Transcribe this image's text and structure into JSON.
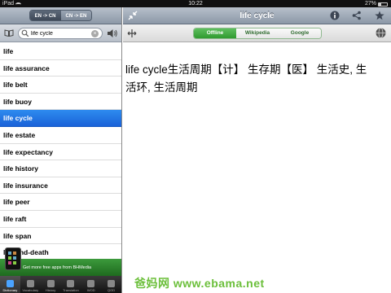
{
  "statusbar": {
    "carrier": "iPad",
    "time": "10:22",
    "battery": "27%"
  },
  "lang_toggle": {
    "en_cn": "EN -> CN",
    "cn_en": "CN -> EN"
  },
  "search": {
    "value": "life cycle",
    "placeholder": ""
  },
  "words": [
    "life",
    "life assurance",
    "life belt",
    "life buoy",
    "life cycle",
    "life estate",
    "life expectancy",
    "life history",
    "life insurance",
    "life peer",
    "life raft",
    "life span",
    "life-and-death"
  ],
  "selected_index": 4,
  "ad": {
    "text": "Get more free apps from BHMedia"
  },
  "tabs": [
    "Dictionary",
    "Vocabulary",
    "History",
    "Translation",
    "WOD",
    "QOD"
  ],
  "detail": {
    "title": "life cycle"
  },
  "sources": {
    "offline": "Offline",
    "wikipedia": "Wikipedia",
    "google": "Google"
  },
  "definition": "life cycle生活周期【计】 生存期【医】 生活史, 生活环, 生活周期",
  "watermark": "爸妈网 www.ebama.net",
  "colors": {
    "accent": "#1a62d8",
    "green": "#2f9a2f",
    "navbar": "#8c98a7"
  }
}
